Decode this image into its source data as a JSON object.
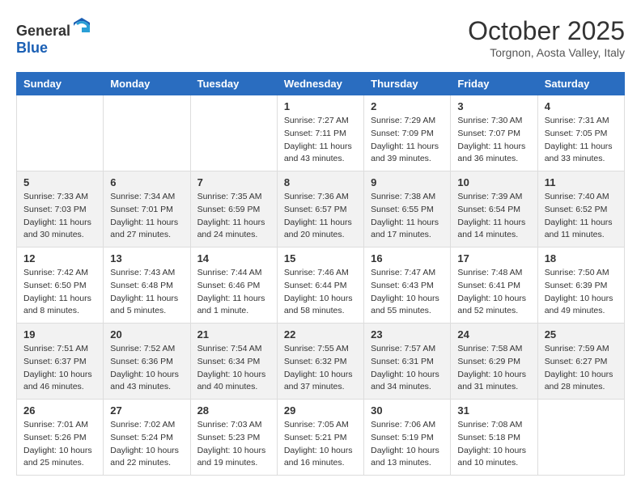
{
  "header": {
    "logo": {
      "general": "General",
      "blue": "Blue"
    },
    "title": "October 2025",
    "location": "Torgnon, Aosta Valley, Italy"
  },
  "calendar": {
    "days_of_week": [
      "Sunday",
      "Monday",
      "Tuesday",
      "Wednesday",
      "Thursday",
      "Friday",
      "Saturday"
    ],
    "weeks": [
      [
        {
          "day": "",
          "sunrise": "",
          "sunset": "",
          "daylight": ""
        },
        {
          "day": "",
          "sunrise": "",
          "sunset": "",
          "daylight": ""
        },
        {
          "day": "",
          "sunrise": "",
          "sunset": "",
          "daylight": ""
        },
        {
          "day": "1",
          "sunrise": "Sunrise: 7:27 AM",
          "sunset": "Sunset: 7:11 PM",
          "daylight": "Daylight: 11 hours and 43 minutes."
        },
        {
          "day": "2",
          "sunrise": "Sunrise: 7:29 AM",
          "sunset": "Sunset: 7:09 PM",
          "daylight": "Daylight: 11 hours and 39 minutes."
        },
        {
          "day": "3",
          "sunrise": "Sunrise: 7:30 AM",
          "sunset": "Sunset: 7:07 PM",
          "daylight": "Daylight: 11 hours and 36 minutes."
        },
        {
          "day": "4",
          "sunrise": "Sunrise: 7:31 AM",
          "sunset": "Sunset: 7:05 PM",
          "daylight": "Daylight: 11 hours and 33 minutes."
        }
      ],
      [
        {
          "day": "5",
          "sunrise": "Sunrise: 7:33 AM",
          "sunset": "Sunset: 7:03 PM",
          "daylight": "Daylight: 11 hours and 30 minutes."
        },
        {
          "day": "6",
          "sunrise": "Sunrise: 7:34 AM",
          "sunset": "Sunset: 7:01 PM",
          "daylight": "Daylight: 11 hours and 27 minutes."
        },
        {
          "day": "7",
          "sunrise": "Sunrise: 7:35 AM",
          "sunset": "Sunset: 6:59 PM",
          "daylight": "Daylight: 11 hours and 24 minutes."
        },
        {
          "day": "8",
          "sunrise": "Sunrise: 7:36 AM",
          "sunset": "Sunset: 6:57 PM",
          "daylight": "Daylight: 11 hours and 20 minutes."
        },
        {
          "day": "9",
          "sunrise": "Sunrise: 7:38 AM",
          "sunset": "Sunset: 6:55 PM",
          "daylight": "Daylight: 11 hours and 17 minutes."
        },
        {
          "day": "10",
          "sunrise": "Sunrise: 7:39 AM",
          "sunset": "Sunset: 6:54 PM",
          "daylight": "Daylight: 11 hours and 14 minutes."
        },
        {
          "day": "11",
          "sunrise": "Sunrise: 7:40 AM",
          "sunset": "Sunset: 6:52 PM",
          "daylight": "Daylight: 11 hours and 11 minutes."
        }
      ],
      [
        {
          "day": "12",
          "sunrise": "Sunrise: 7:42 AM",
          "sunset": "Sunset: 6:50 PM",
          "daylight": "Daylight: 11 hours and 8 minutes."
        },
        {
          "day": "13",
          "sunrise": "Sunrise: 7:43 AM",
          "sunset": "Sunset: 6:48 PM",
          "daylight": "Daylight: 11 hours and 5 minutes."
        },
        {
          "day": "14",
          "sunrise": "Sunrise: 7:44 AM",
          "sunset": "Sunset: 6:46 PM",
          "daylight": "Daylight: 11 hours and 1 minute."
        },
        {
          "day": "15",
          "sunrise": "Sunrise: 7:46 AM",
          "sunset": "Sunset: 6:44 PM",
          "daylight": "Daylight: 10 hours and 58 minutes."
        },
        {
          "day": "16",
          "sunrise": "Sunrise: 7:47 AM",
          "sunset": "Sunset: 6:43 PM",
          "daylight": "Daylight: 10 hours and 55 minutes."
        },
        {
          "day": "17",
          "sunrise": "Sunrise: 7:48 AM",
          "sunset": "Sunset: 6:41 PM",
          "daylight": "Daylight: 10 hours and 52 minutes."
        },
        {
          "day": "18",
          "sunrise": "Sunrise: 7:50 AM",
          "sunset": "Sunset: 6:39 PM",
          "daylight": "Daylight: 10 hours and 49 minutes."
        }
      ],
      [
        {
          "day": "19",
          "sunrise": "Sunrise: 7:51 AM",
          "sunset": "Sunset: 6:37 PM",
          "daylight": "Daylight: 10 hours and 46 minutes."
        },
        {
          "day": "20",
          "sunrise": "Sunrise: 7:52 AM",
          "sunset": "Sunset: 6:36 PM",
          "daylight": "Daylight: 10 hours and 43 minutes."
        },
        {
          "day": "21",
          "sunrise": "Sunrise: 7:54 AM",
          "sunset": "Sunset: 6:34 PM",
          "daylight": "Daylight: 10 hours and 40 minutes."
        },
        {
          "day": "22",
          "sunrise": "Sunrise: 7:55 AM",
          "sunset": "Sunset: 6:32 PM",
          "daylight": "Daylight: 10 hours and 37 minutes."
        },
        {
          "day": "23",
          "sunrise": "Sunrise: 7:57 AM",
          "sunset": "Sunset: 6:31 PM",
          "daylight": "Daylight: 10 hours and 34 minutes."
        },
        {
          "day": "24",
          "sunrise": "Sunrise: 7:58 AM",
          "sunset": "Sunset: 6:29 PM",
          "daylight": "Daylight: 10 hours and 31 minutes."
        },
        {
          "day": "25",
          "sunrise": "Sunrise: 7:59 AM",
          "sunset": "Sunset: 6:27 PM",
          "daylight": "Daylight: 10 hours and 28 minutes."
        }
      ],
      [
        {
          "day": "26",
          "sunrise": "Sunrise: 7:01 AM",
          "sunset": "Sunset: 5:26 PM",
          "daylight": "Daylight: 10 hours and 25 minutes."
        },
        {
          "day": "27",
          "sunrise": "Sunrise: 7:02 AM",
          "sunset": "Sunset: 5:24 PM",
          "daylight": "Daylight: 10 hours and 22 minutes."
        },
        {
          "day": "28",
          "sunrise": "Sunrise: 7:03 AM",
          "sunset": "Sunset: 5:23 PM",
          "daylight": "Daylight: 10 hours and 19 minutes."
        },
        {
          "day": "29",
          "sunrise": "Sunrise: 7:05 AM",
          "sunset": "Sunset: 5:21 PM",
          "daylight": "Daylight: 10 hours and 16 minutes."
        },
        {
          "day": "30",
          "sunrise": "Sunrise: 7:06 AM",
          "sunset": "Sunset: 5:19 PM",
          "daylight": "Daylight: 10 hours and 13 minutes."
        },
        {
          "day": "31",
          "sunrise": "Sunrise: 7:08 AM",
          "sunset": "Sunset: 5:18 PM",
          "daylight": "Daylight: 10 hours and 10 minutes."
        },
        {
          "day": "",
          "sunrise": "",
          "sunset": "",
          "daylight": ""
        }
      ]
    ]
  }
}
